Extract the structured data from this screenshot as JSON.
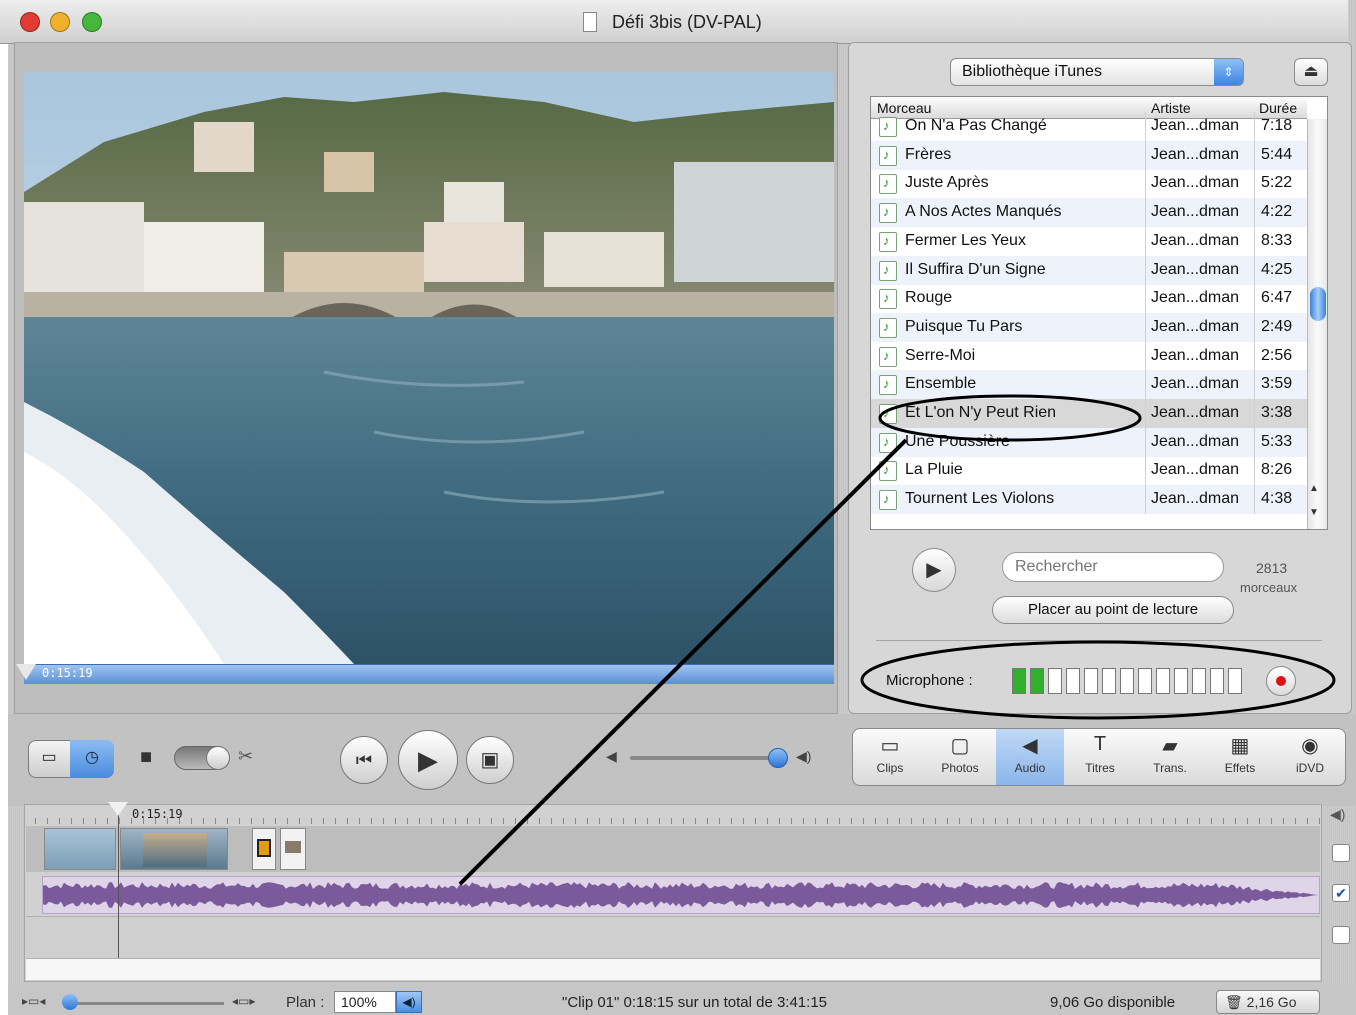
{
  "window": {
    "title": "Défi 3bis (DV-PAL)",
    "traffic_colors": [
      "#e23b32",
      "#f2b12a",
      "#45b83b"
    ]
  },
  "viewer": {
    "timecode": "0:15:19"
  },
  "library": {
    "source": "Bibliothèque iTunes",
    "columns": {
      "title": "Morceau",
      "artist": "Artiste",
      "duration": "Durée"
    },
    "tracks": [
      {
        "title": "On N'a Pas Changé",
        "artist": "Jean...dman",
        "duration": "7:18"
      },
      {
        "title": "Frères",
        "artist": "Jean...dman",
        "duration": "5:44"
      },
      {
        "title": "Juste Après",
        "artist": "Jean...dman",
        "duration": "5:22"
      },
      {
        "title": "A Nos Actes Manqués",
        "artist": "Jean...dman",
        "duration": "4:22"
      },
      {
        "title": "Fermer Les Yeux",
        "artist": "Jean...dman",
        "duration": "8:33"
      },
      {
        "title": "Il Suffira D'un Signe",
        "artist": "Jean...dman",
        "duration": "4:25"
      },
      {
        "title": "Rouge",
        "artist": "Jean...dman",
        "duration": "6:47"
      },
      {
        "title": "Puisque Tu Pars",
        "artist": "Jean...dman",
        "duration": "2:49"
      },
      {
        "title": "Serre-Moi",
        "artist": "Jean...dman",
        "duration": "2:56"
      },
      {
        "title": "Ensemble",
        "artist": "Jean...dman",
        "duration": "3:59"
      },
      {
        "title": "Et L'on N'y Peut Rien",
        "artist": "Jean...dman",
        "duration": "3:38"
      },
      {
        "title": "Une Poussière",
        "artist": "Jean...dman",
        "duration": "5:33"
      },
      {
        "title": "La Pluie",
        "artist": "Jean...dman",
        "duration": "8:26"
      },
      {
        "title": "Tournent Les Violons",
        "artist": "Jean...dman",
        "duration": "4:38"
      }
    ],
    "selected_index": 10,
    "search_placeholder": "Rechercher",
    "count_number": "2813",
    "count_label": "morceaux",
    "place_button": "Placer au point de lecture",
    "mic_label": "Microphone :",
    "mic_level_active": 2,
    "mic_level_total": 13
  },
  "transport": {
    "rewind": "⏮",
    "play": "▶",
    "fullscreen": "▣"
  },
  "pane_tabs": [
    {
      "label": "Clips",
      "icon": "clips-icon"
    },
    {
      "label": "Photos",
      "icon": "photos-icon"
    },
    {
      "label": "Audio",
      "icon": "audio-icon"
    },
    {
      "label": "Titres",
      "icon": "titles-icon"
    },
    {
      "label": "Trans.",
      "icon": "transitions-icon"
    },
    {
      "label": "Effets",
      "icon": "effects-icon"
    },
    {
      "label": "iDVD",
      "icon": "idvd-icon"
    }
  ],
  "active_tab": "Audio",
  "timeline": {
    "playhead_time": "0:15:19",
    "audio_color": "#7a5a9a"
  },
  "status": {
    "plan_label": "Plan :",
    "plan_value": "100%",
    "clip_info": "\"Clip 01\"  0:18:15 sur un total de 3:41:15",
    "disk": "9,06 Go disponible",
    "trash": "2,16 Go"
  }
}
